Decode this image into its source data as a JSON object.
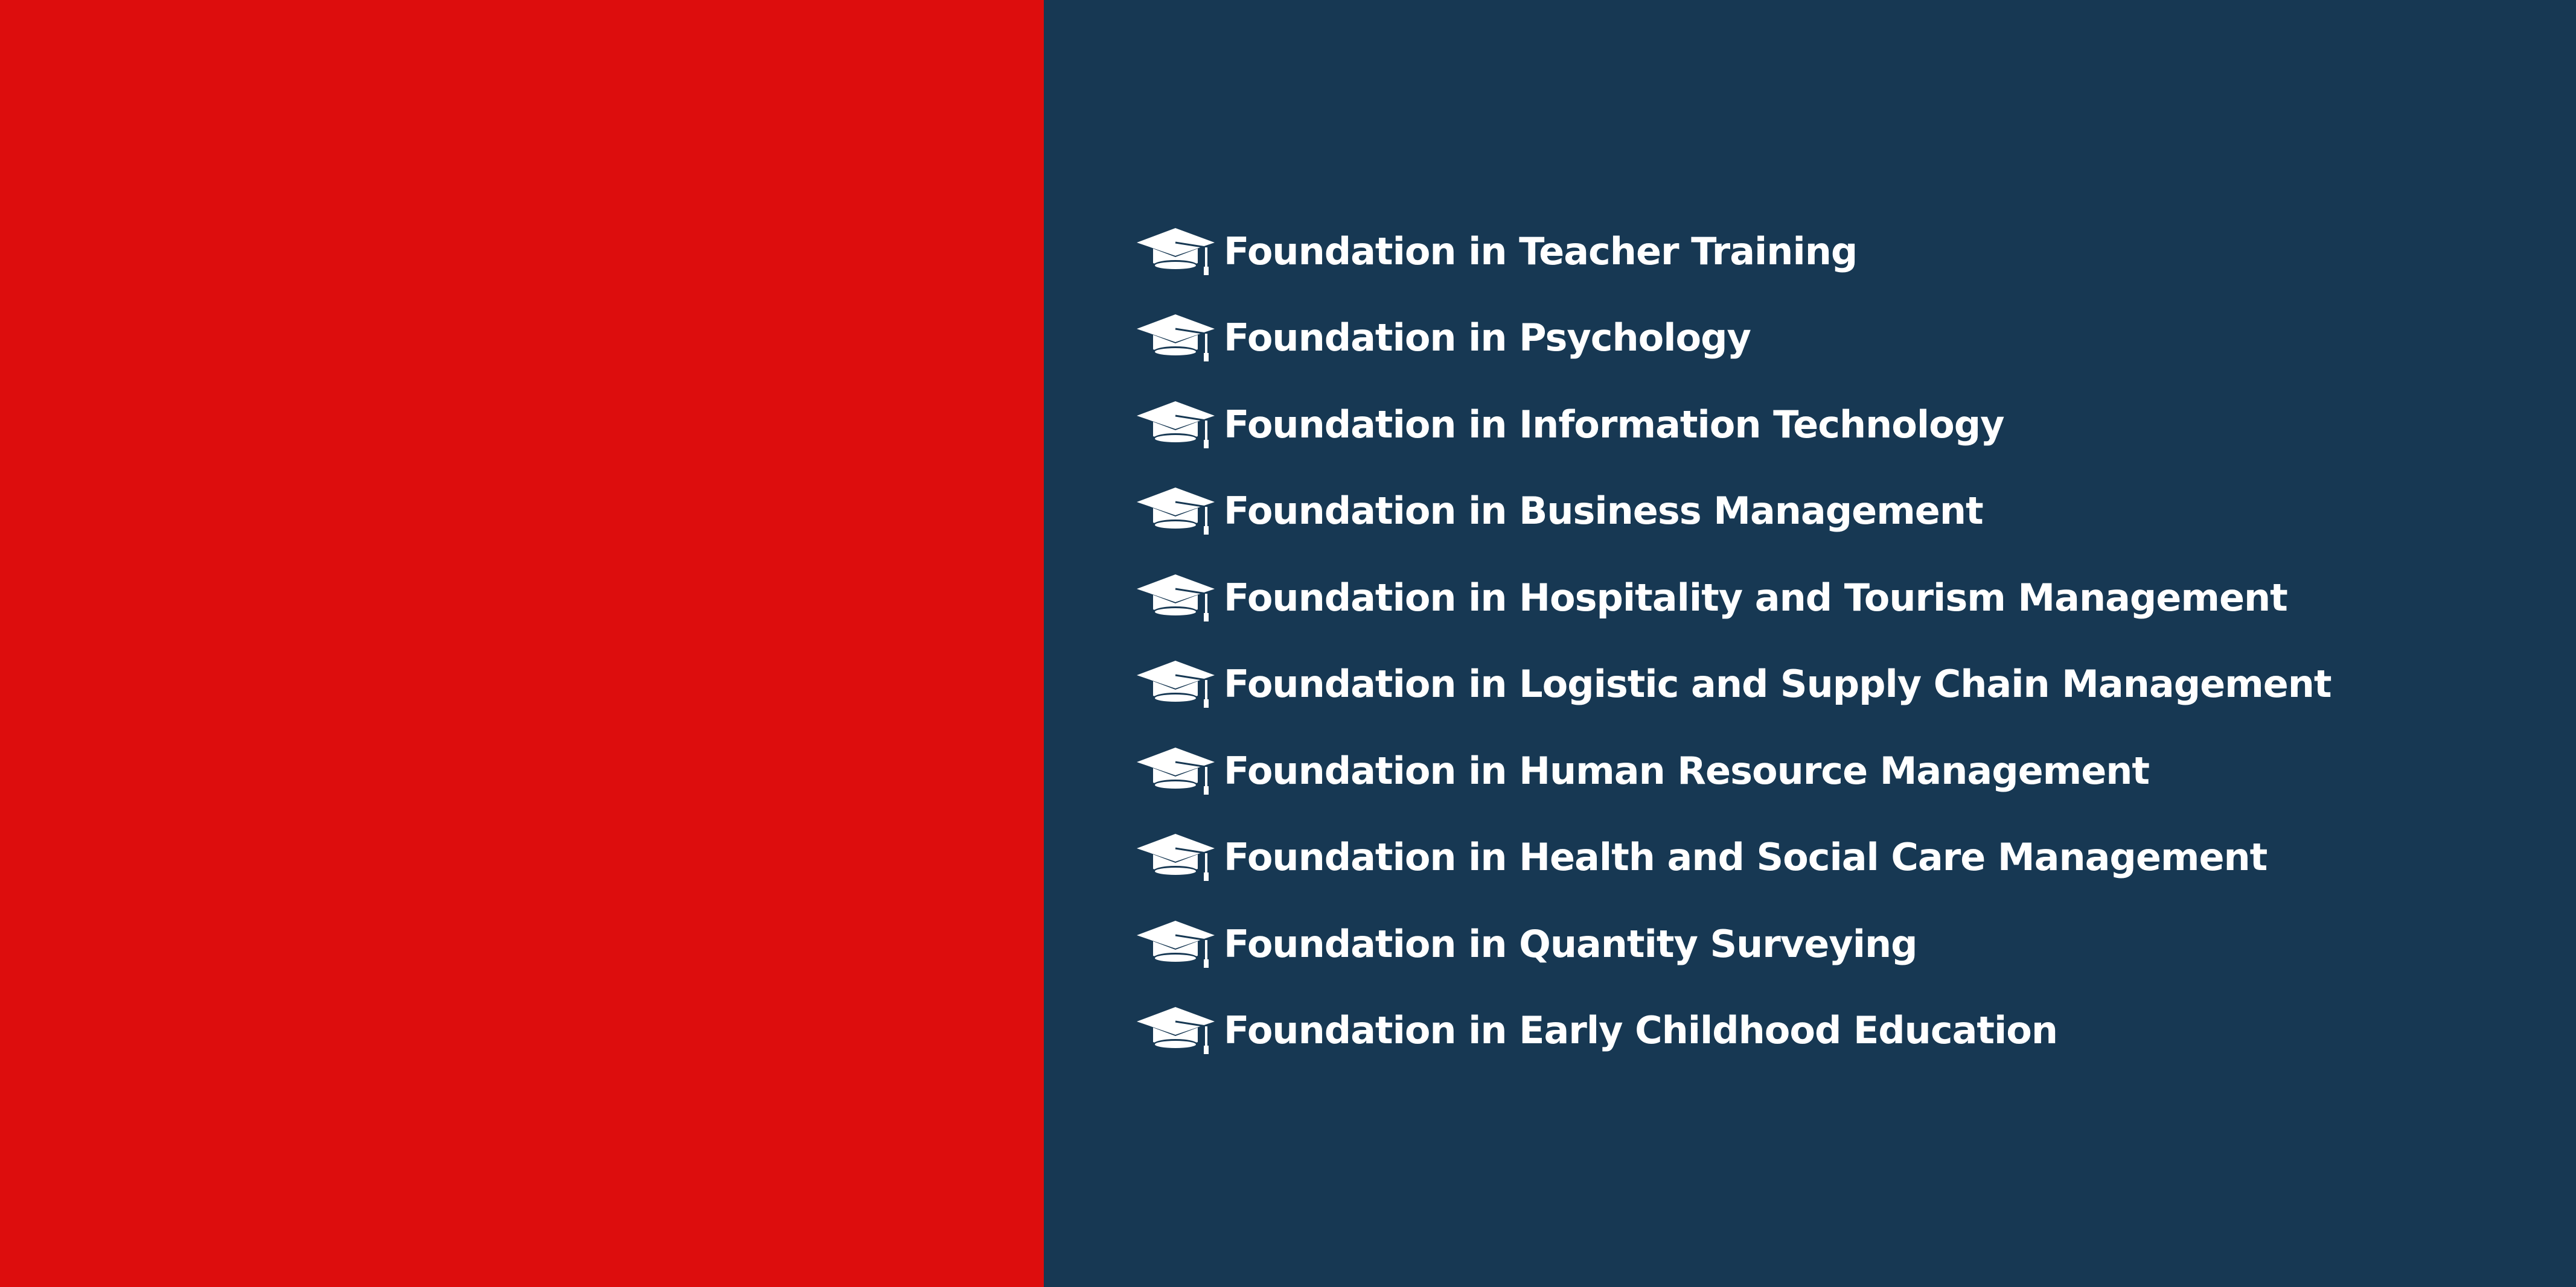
{
  "colors": {
    "left_panel": "#dd0d0d",
    "right_panel": "#173853",
    "text": "#ffffff"
  },
  "course_list": {
    "icon": "graduation-cap-icon",
    "items": [
      {
        "label": "Foundation in Teacher Training"
      },
      {
        "label": "Foundation in Psychology"
      },
      {
        "label": "Foundation in Information Technology"
      },
      {
        "label": "Foundation in Business Management"
      },
      {
        "label": "Foundation in Hospitality and Tourism Management"
      },
      {
        "label": "Foundation in Logistic and Supply Chain Management"
      },
      {
        "label": "Foundation in Human Resource Management"
      },
      {
        "label": "Foundation in Health and Social Care Management"
      },
      {
        "label": "Foundation in Quantity Surveying"
      },
      {
        "label": "Foundation in Early Childhood Education"
      }
    ]
  }
}
